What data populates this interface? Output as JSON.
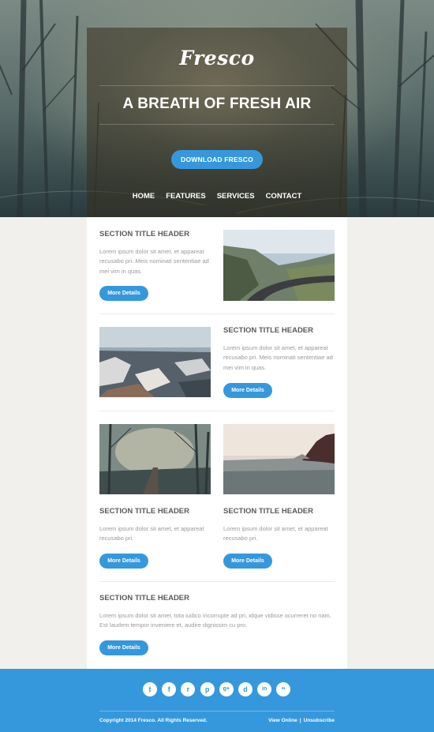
{
  "hero": {
    "logo": "Fresco",
    "tagline": "A BREATH OF FRESH AIR",
    "cta_label": "DOWNLOAD FRESCO",
    "nav": [
      "HOME",
      "FEATURES",
      "SERVICES",
      "CONTACT"
    ]
  },
  "sections": {
    "s1": {
      "title": "SECTION TITLE HEADER",
      "body": "Lorem ipsum dolor sit amet, et appareat recusabo pri. Meis nominati sententiae ad mei vim in quas.",
      "button": "More Details",
      "image": "mountain-road-photo"
    },
    "s2": {
      "title": "SECTION TITLE HEADER",
      "body": "Lorem ipsum dolor sit amet, et appareat recusabo pri. Meis nominati sententiae ad mei vim in quas.",
      "button": "More Details",
      "image": "snowy-town-photo"
    },
    "s3a": {
      "title": "SECTION TITLE HEADER",
      "body": "Lorem ipsum dolor sit amet, et appareat recusabo pri.",
      "button": "More Details",
      "image": "foggy-railway-photo"
    },
    "s3b": {
      "title": "SECTION TITLE HEADER",
      "body": "Lorem ipsum dolor sit amet, et appareat recusabo pri.",
      "button": "More Details",
      "image": "seaside-cliff-photo"
    },
    "s4": {
      "title": "SECTION TITLE HEADER",
      "body": "Lorem ipsum dolor sit amet, tota iudico incorrupte ad pri, idque vidisse ocurreret no nam. Est laudem tempor inveniere et, audire dignissim cu pro.",
      "button": "More Details"
    }
  },
  "footer": {
    "socials": [
      "twitter-icon",
      "facebook-icon",
      "rss-icon",
      "pinterest-icon",
      "google-plus-icon",
      "dribbble-icon",
      "linkedin-icon",
      "flickr-icon"
    ],
    "social_glyphs": [
      "t",
      "f",
      "r",
      "p",
      "g+",
      "d",
      "in",
      "••"
    ],
    "copyright": "Copyright 2014 Fresco. All Rights Reserved.",
    "view_online": "View Online",
    "separator": "|",
    "unsubscribe": "Unsubscribe"
  },
  "colors": {
    "accent": "#3598dc",
    "page_bg": "#f2f0ec",
    "card_bg": "#ffffff",
    "title": "#5a5a5a",
    "body_text": "#9a9a9a"
  }
}
